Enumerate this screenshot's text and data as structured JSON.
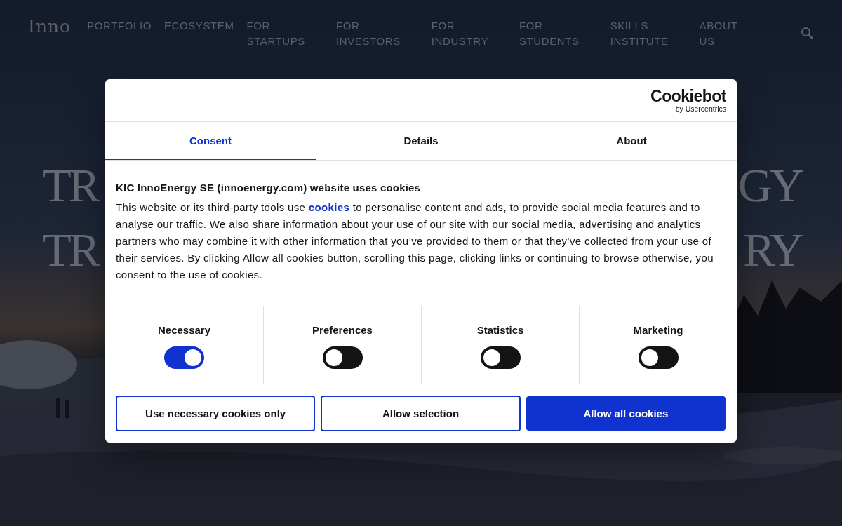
{
  "nav": {
    "logo": "Inno",
    "items": [
      "PORTFOLIO",
      "ECOSYSTEM",
      "FOR STARTUPS",
      "FOR INVESTORS",
      "FOR INDUSTRY",
      "FOR STUDENTS",
      "SKILLS INSTITUTE",
      "ABOUT US"
    ]
  },
  "hero": {
    "lines": [
      {
        "left": "TR",
        "right": "GY"
      },
      {
        "left": "TR",
        "right": "RY"
      }
    ]
  },
  "dialog": {
    "brand": {
      "name": "Cookiebot",
      "byline": "by Usercentrics"
    },
    "tabs": [
      {
        "label": "Consent",
        "selected": true
      },
      {
        "label": "Details",
        "selected": false
      },
      {
        "label": "About",
        "selected": false
      }
    ],
    "heading": "KIC InnoEnergy SE (innoenergy.com) website uses cookies",
    "body": {
      "before": "This website or its third-party tools use",
      "link": "cookies",
      "after": "to personalise content and ads, to provide social media features and to analyse our traffic. We also share information about your use of our site with our social media, advertising and analytics partners who may combine it with other information that you’ve provided to them or that they’ve collected from your use of their services. By clicking Allow all cookies button, scrolling this page, clicking links or continuing to browse otherwise, you consent to the use of cookies."
    },
    "categories": [
      {
        "label": "Necessary",
        "on": true
      },
      {
        "label": "Preferences",
        "on": false
      },
      {
        "label": "Statistics",
        "on": false
      },
      {
        "label": "Marketing",
        "on": false
      }
    ],
    "buttons": [
      {
        "label": "Use necessary cookies only",
        "kind": "outline"
      },
      {
        "label": "Allow selection",
        "kind": "outline"
      },
      {
        "label": "Allow all cookies",
        "kind": "primary"
      }
    ]
  }
}
